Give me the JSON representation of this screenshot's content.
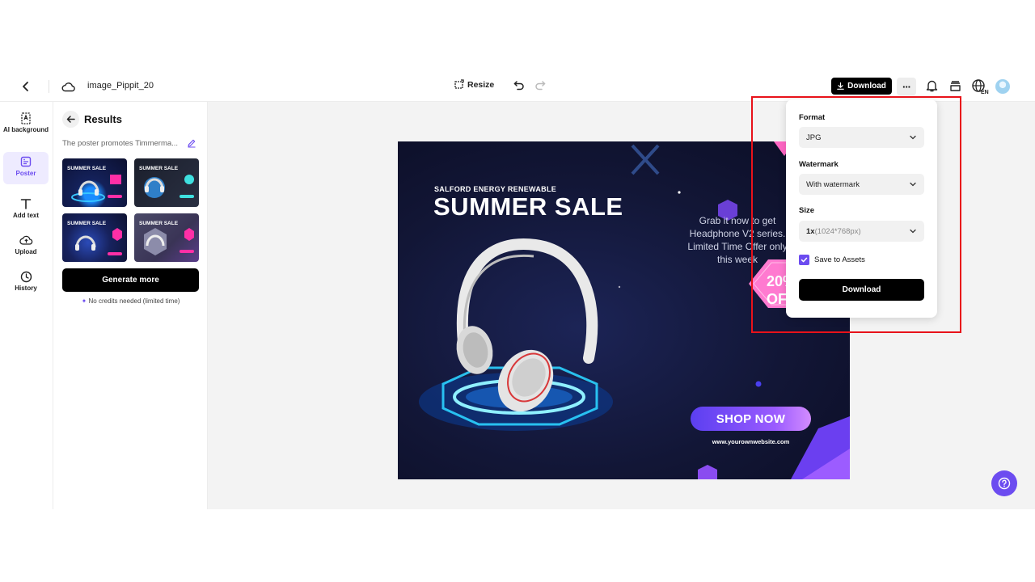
{
  "header": {
    "file_title": "image_Pippit_20",
    "resize_label": "Resize",
    "download_label": "Download",
    "more_label": "···",
    "language_badge": "EN"
  },
  "rail": {
    "items": [
      {
        "label": "AI background",
        "icon": "ai-background-icon"
      },
      {
        "label": "Poster",
        "icon": "poster-icon",
        "active": true
      },
      {
        "label": "Add text",
        "icon": "text-icon"
      },
      {
        "label": "Upload",
        "icon": "upload-icon"
      },
      {
        "label": "History",
        "icon": "clock-icon"
      }
    ]
  },
  "panel": {
    "title": "Results",
    "prompt": "The poster promotes Timmerma...",
    "generate_label": "Generate more",
    "credits_note": "No credits needed (limited time)",
    "thumbnails": [
      {
        "title": "SUMMER SALE"
      },
      {
        "title": "SUMMER SALE"
      },
      {
        "title": "SUMMER SALE"
      },
      {
        "title": "SUMMER SALE"
      }
    ]
  },
  "poster": {
    "subtitle": "SALFORD ENERGY RENEWABLE",
    "title": "SUMMER SALE",
    "body": "Grab it now to get Headphone V2 series. Limited Time Offer only this week",
    "shop_label": "SHOP NOW",
    "url": "www.yourownwebsite.com",
    "badge_line1": "20%",
    "badge_line2": "OFF"
  },
  "download_menu": {
    "format_label": "Format",
    "format_value": "JPG",
    "watermark_label": "Watermark",
    "watermark_value": "With watermark",
    "size_label": "Size",
    "size_value": "1x",
    "size_detail": "(1024*768px)",
    "save_label": "Save to Assets",
    "save_checked": true,
    "download_label": "Download"
  },
  "colors": {
    "accent": "#6c4cf0",
    "highlight": "#e8121a"
  }
}
